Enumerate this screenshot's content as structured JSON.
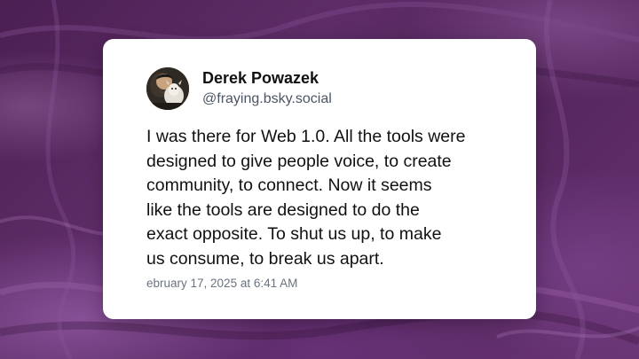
{
  "background": {
    "style": "purple marbled abstract",
    "colors": [
      "#4a1f52",
      "#5e2d68",
      "#6a3574",
      "#a86ebe"
    ]
  },
  "post": {
    "author": {
      "display_name": "Derek Powazek",
      "handle": "@fraying.bsky.social",
      "avatar_icon": "avatar-photo-icon"
    },
    "text_lines": [
      "I was there for Web 1.0. All the tools were",
      "designed to give people voice, to create",
      "community, to connect. Now it seems",
      "like the tools are designed to do the",
      "exact opposite. To shut us up, to make",
      "us consume, to break us apart."
    ],
    "timestamp": "ebruary 17, 2025 at 6:41 AM"
  },
  "colors": {
    "card": "#ffffff",
    "name": "#111111",
    "handle": "#4b5563",
    "timestamp": "#6b7280"
  }
}
